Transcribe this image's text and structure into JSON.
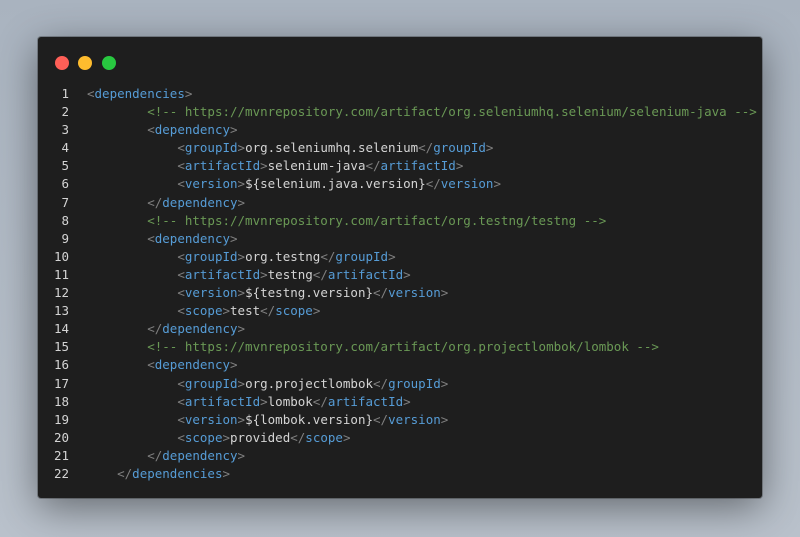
{
  "window_controls": [
    "close",
    "minimize",
    "maximize"
  ],
  "lines": [
    {
      "n": "1",
      "indent": "",
      "type": "open",
      "tag": "dependencies"
    },
    {
      "n": "2",
      "indent": "        ",
      "type": "comment",
      "text": "<!-- https://mvnrepository.com/artifact/org.seleniumhq.selenium/selenium-java -->"
    },
    {
      "n": "3",
      "indent": "        ",
      "type": "open",
      "tag": "dependency"
    },
    {
      "n": "4",
      "indent": "            ",
      "type": "element",
      "tag": "groupId",
      "value": "org.seleniumhq.selenium"
    },
    {
      "n": "5",
      "indent": "            ",
      "type": "element",
      "tag": "artifactId",
      "value": "selenium-java"
    },
    {
      "n": "6",
      "indent": "            ",
      "type": "element",
      "tag": "version",
      "value": "${selenium.java.version}"
    },
    {
      "n": "7",
      "indent": "        ",
      "type": "close",
      "tag": "dependency"
    },
    {
      "n": "8",
      "indent": "        ",
      "type": "comment",
      "text": "<!-- https://mvnrepository.com/artifact/org.testng/testng -->"
    },
    {
      "n": "9",
      "indent": "        ",
      "type": "open",
      "tag": "dependency"
    },
    {
      "n": "10",
      "indent": "            ",
      "type": "element",
      "tag": "groupId",
      "value": "org.testng"
    },
    {
      "n": "11",
      "indent": "            ",
      "type": "element",
      "tag": "artifactId",
      "value": "testng"
    },
    {
      "n": "12",
      "indent": "            ",
      "type": "element",
      "tag": "version",
      "value": "${testng.version}"
    },
    {
      "n": "13",
      "indent": "            ",
      "type": "element",
      "tag": "scope",
      "value": "test"
    },
    {
      "n": "14",
      "indent": "        ",
      "type": "close",
      "tag": "dependency"
    },
    {
      "n": "15",
      "indent": "        ",
      "type": "comment",
      "text": "<!-- https://mvnrepository.com/artifact/org.projectlombok/lombok -->"
    },
    {
      "n": "16",
      "indent": "        ",
      "type": "open",
      "tag": "dependency"
    },
    {
      "n": "17",
      "indent": "            ",
      "type": "element",
      "tag": "groupId",
      "value": "org.projectlombok"
    },
    {
      "n": "18",
      "indent": "            ",
      "type": "element",
      "tag": "artifactId",
      "value": "lombok"
    },
    {
      "n": "19",
      "indent": "            ",
      "type": "element",
      "tag": "version",
      "value": "${lombok.version}"
    },
    {
      "n": "20",
      "indent": "            ",
      "type": "element",
      "tag": "scope",
      "value": "provided"
    },
    {
      "n": "21",
      "indent": "        ",
      "type": "close",
      "tag": "dependency"
    },
    {
      "n": "22",
      "indent": "    ",
      "type": "close",
      "tag": "dependencies"
    }
  ]
}
